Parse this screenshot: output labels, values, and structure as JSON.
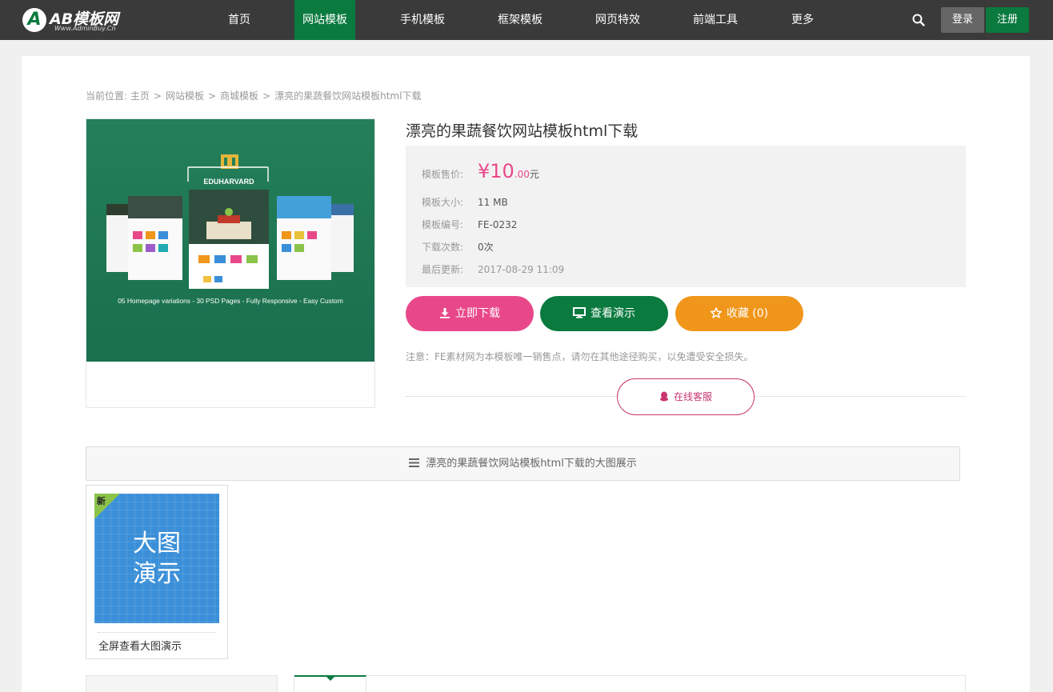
{
  "brand": {
    "logo_letter": "A",
    "name": "AB模板网",
    "tagline": "Www.AdminBuy.Cn"
  },
  "nav": {
    "items": [
      {
        "label": "首页",
        "active": false
      },
      {
        "label": "网站模板",
        "active": true
      },
      {
        "label": "手机模板",
        "active": false
      },
      {
        "label": "框架模板",
        "active": false
      },
      {
        "label": "网页特效",
        "active": false
      },
      {
        "label": "前端工具",
        "active": false
      },
      {
        "label": "更多",
        "active": false
      }
    ],
    "login_label": "登录",
    "register_label": "注册"
  },
  "breadcrumb": {
    "prefix": "当前位置:",
    "items": [
      "主页",
      "网站模板",
      "商城模板",
      "漂亮的果蔬餐饮网站模板html下载"
    ],
    "separator": ">"
  },
  "thumbnail": {
    "brand": "EDUHARVARD",
    "caption": "05 Homepage variations - 30 PSD Pages - Fully Responsive - Easy Custom"
  },
  "product": {
    "title": "漂亮的果蔬餐饮网站模板html下载",
    "price_label": "模板售价:",
    "price_symbol": "¥",
    "price_int": "10",
    "price_dec": ".00",
    "price_unit": "元",
    "size_label": "模板大小:",
    "size_value": "11 MB",
    "code_label": "模板编号:",
    "code_value": "FE-0232",
    "downloads_label": "下载次数:",
    "downloads_value": "0次",
    "updated_label": "最后更新:",
    "updated_value": "2017-08-29 11:09"
  },
  "actions": {
    "download_label": "立即下载",
    "demo_label": "查看演示",
    "favorite_label": "收藏 (0)"
  },
  "notice": "注意：FE素材网为本模板唯一销售点，请勿在其他途径购买，以免遭受安全损失。",
  "service_label": "在线客服",
  "bigpic": {
    "bar_label": "漂亮的果蔬餐饮网站模板html下载的大图展示",
    "badge": "新",
    "line1": "大图",
    "line2": "演示",
    "caption": "全屏查看大图演示"
  },
  "colors": {
    "brand_green": "#0a7a3f",
    "accent_pink": "#e8488a",
    "accent_orange": "#f0961a"
  }
}
